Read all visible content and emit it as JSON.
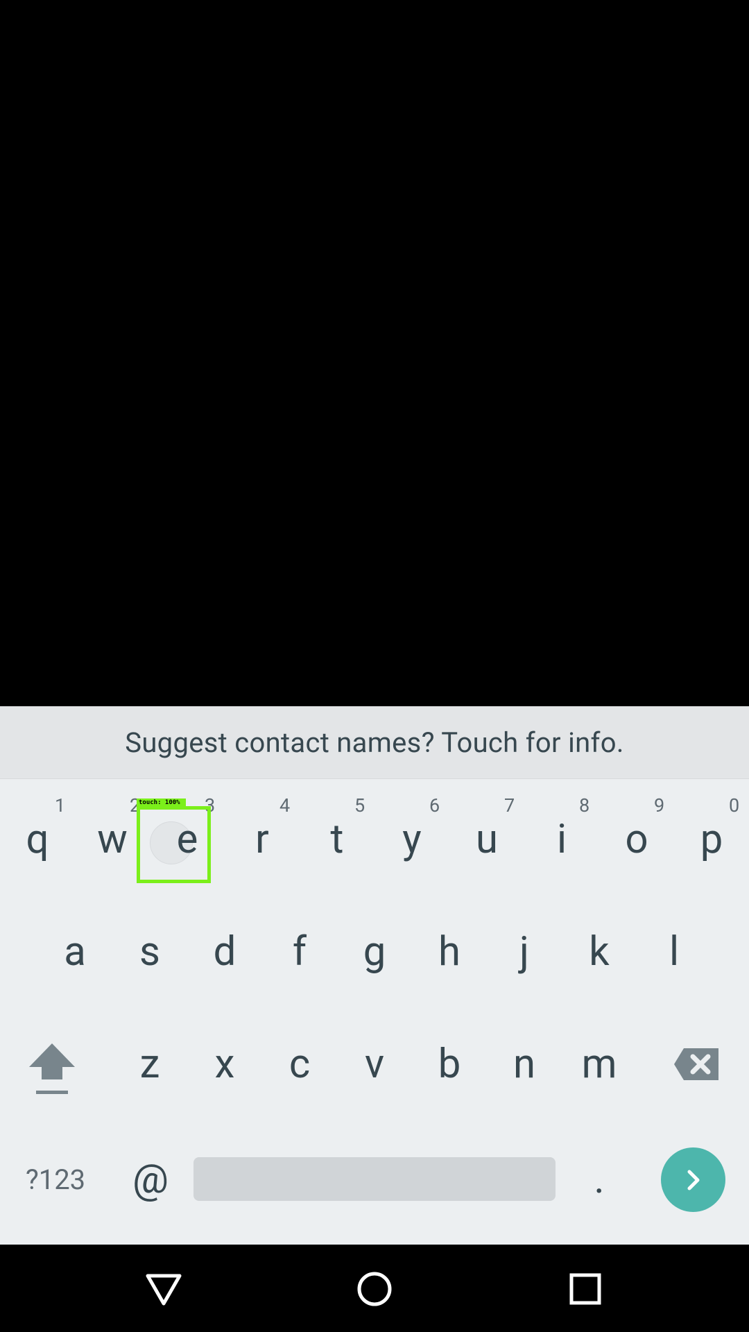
{
  "suggestion": {
    "text": "Suggest contact names? Touch for info."
  },
  "keyboard": {
    "row1": [
      {
        "letter": "q",
        "hint": "1"
      },
      {
        "letter": "w",
        "hint": "2"
      },
      {
        "letter": "e",
        "hint": "3"
      },
      {
        "letter": "r",
        "hint": "4"
      },
      {
        "letter": "t",
        "hint": "5"
      },
      {
        "letter": "y",
        "hint": "6"
      },
      {
        "letter": "u",
        "hint": "7"
      },
      {
        "letter": "i",
        "hint": "8"
      },
      {
        "letter": "o",
        "hint": "9"
      },
      {
        "letter": "p",
        "hint": "0"
      }
    ],
    "row2": [
      "a",
      "s",
      "d",
      "f",
      "g",
      "h",
      "j",
      "k",
      "l"
    ],
    "row3": [
      "z",
      "x",
      "c",
      "v",
      "b",
      "n",
      "m"
    ],
    "symbols_label": "?123",
    "at_label": "@",
    "period_label": "."
  },
  "touch_overlay": {
    "label": "touch: 100%"
  },
  "icons": {
    "shift": "shift-icon",
    "backspace": "backspace-icon",
    "go": "chevron-right-icon",
    "back": "nav-back-icon",
    "home": "nav-home-icon",
    "recents": "nav-recents-icon"
  },
  "colors": {
    "accent": "#4db6ac",
    "touch_highlight": "#7bef1a"
  }
}
